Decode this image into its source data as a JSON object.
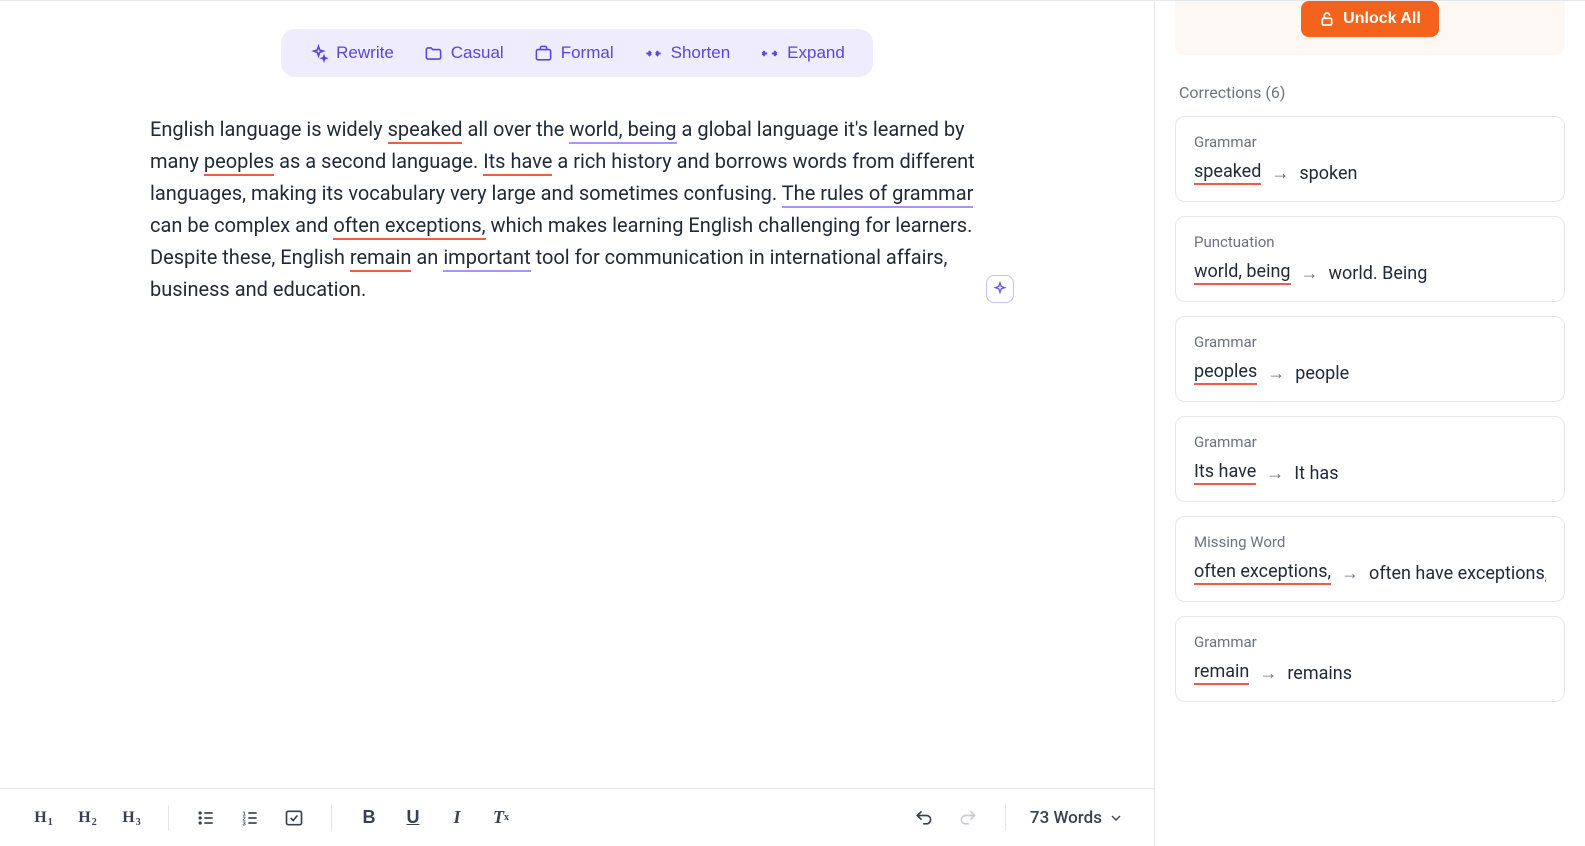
{
  "toolbar": {
    "rewrite": "Rewrite",
    "casual": "Casual",
    "formal": "Formal",
    "shorten": "Shorten",
    "expand": "Expand"
  },
  "editor": {
    "segments": [
      {
        "t": "English language is widely "
      },
      {
        "t": "speaked",
        "u": "red"
      },
      {
        "t": " all over the "
      },
      {
        "t": "world, being",
        "u": "purple"
      },
      {
        "t": " a global language it's learned by many "
      },
      {
        "t": "peoples",
        "u": "red"
      },
      {
        "t": " as a second language. "
      },
      {
        "t": "Its have",
        "u": "red"
      },
      {
        "t": " a rich history and borrows words from different languages, making its vocabulary very large and sometimes confusing. "
      },
      {
        "t": "The rules of grammar",
        "u": "purple"
      },
      {
        "t": " can be complex and "
      },
      {
        "t": "often exceptions,",
        "u": "red"
      },
      {
        "t": " which makes learning English challenging for learners. Despite these, English "
      },
      {
        "t": "remain",
        "u": "red"
      },
      {
        "t": " an "
      },
      {
        "t": "important",
        "u": "purple"
      },
      {
        "t": " tool for communication in international affairs, business and education."
      }
    ]
  },
  "bottombar": {
    "word_count": "73 Words"
  },
  "right": {
    "unlock": "Unlock All",
    "corrections_label": "Corrections (6)",
    "cards": [
      {
        "cat": "Grammar",
        "from": "speaked",
        "to": "spoken"
      },
      {
        "cat": "Punctuation",
        "from": "world, being",
        "to": "world. Being"
      },
      {
        "cat": "Grammar",
        "from": "peoples",
        "to": "people"
      },
      {
        "cat": "Grammar",
        "from": "Its have",
        "to": "It has"
      },
      {
        "cat": "Missing Word",
        "from": "often exceptions,",
        "to": "often have exceptions,"
      },
      {
        "cat": "Grammar",
        "from": "remain",
        "to": "remains"
      }
    ]
  }
}
